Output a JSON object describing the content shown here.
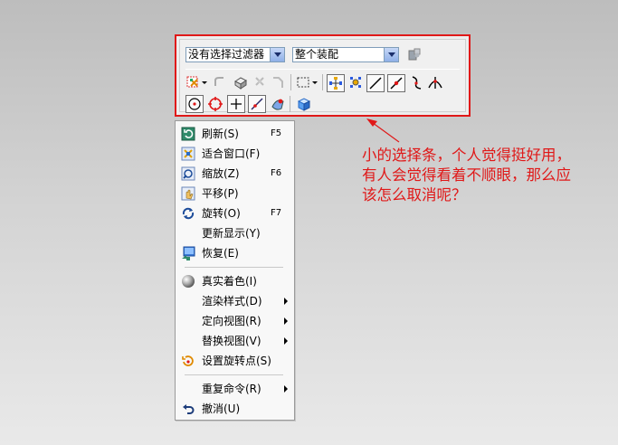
{
  "selection_bar": {
    "filter_combo": "没有选择过滤器",
    "scope_combo": "整个装配"
  },
  "menu": {
    "items": [
      {
        "label": "刷新(S)",
        "shortcut": "F5",
        "icon": "refresh-icon"
      },
      {
        "label": "适合窗口(F)",
        "shortcut": "",
        "icon": "fit-window-icon"
      },
      {
        "label": "缩放(Z)",
        "shortcut": "F6",
        "icon": "zoom-icon"
      },
      {
        "label": "平移(P)",
        "shortcut": "",
        "icon": "pan-icon"
      },
      {
        "label": "旋转(O)",
        "shortcut": "F7",
        "icon": "rotate-icon"
      },
      {
        "label": "更新显示(Y)",
        "shortcut": "",
        "icon": ""
      },
      {
        "label": "恢复(E)",
        "shortcut": "",
        "icon": "restore-icon"
      },
      {
        "label": "真实着色(I)",
        "shortcut": "",
        "icon": "true-shading-icon"
      },
      {
        "label": "渲染样式(D)",
        "shortcut": "",
        "icon": "",
        "submenu": true
      },
      {
        "label": "定向视图(R)",
        "shortcut": "",
        "icon": "",
        "submenu": true
      },
      {
        "label": "替换视图(V)",
        "shortcut": "",
        "icon": "",
        "submenu": true
      },
      {
        "label": "设置旋转点(S)",
        "shortcut": "",
        "icon": "rotate-point-icon"
      },
      {
        "label": "重复命令(R)",
        "shortcut": "",
        "icon": "",
        "submenu": true
      },
      {
        "label": "撤消(U)",
        "shortcut": "",
        "icon": "undo-icon"
      }
    ]
  },
  "annotation": {
    "line1": "小的选择条，个人觉得挺好用，",
    "line2": "有人会觉得看着不顺眼，那么应",
    "line3": "该怎么取消呢？",
    "color": "#e01818"
  }
}
